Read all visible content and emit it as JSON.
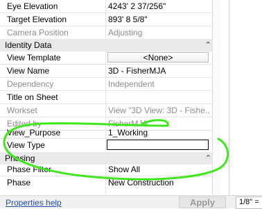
{
  "properties": {
    "camera_rows": [
      {
        "label": "Eye Elevation",
        "value": "4243'  2 37/256\"",
        "disabled": false
      },
      {
        "label": "Target Elevation",
        "value": "893'  8 5/8\"",
        "disabled": false
      },
      {
        "label": "Camera Position",
        "value": "Adjusting",
        "disabled": true
      }
    ],
    "identity_group": {
      "label": "Identity Data",
      "chevron": "⌃"
    },
    "identity_rows": [
      {
        "label": "View Template",
        "value": "<None>",
        "kind": "button",
        "disabled": false
      },
      {
        "label": "View Name",
        "value": "3D - FisherMJA",
        "disabled": false
      },
      {
        "label": "Dependency",
        "value": "Independent",
        "disabled": true
      },
      {
        "label": "Title on Sheet",
        "value": "",
        "disabled": false
      },
      {
        "label": "Workset",
        "value": "View \"3D View: 3D - Fishe...",
        "disabled": true
      },
      {
        "label": "Edited by",
        "value": "FisherMJA",
        "disabled": true
      },
      {
        "label": "View_Purpose",
        "value": "1_Working",
        "disabled": false
      },
      {
        "label": "View Type",
        "value": "",
        "kind": "edit",
        "disabled": false
      }
    ],
    "phasing_group": {
      "label": "Phasing",
      "chevron": "⌃"
    },
    "phasing_rows": [
      {
        "label": "Phase Filter",
        "value": "Show All",
        "disabled": false
      },
      {
        "label": "Phase",
        "value": "New Construction",
        "disabled": false
      }
    ]
  },
  "footer": {
    "help_link": "Properties help",
    "apply_label": "Apply"
  },
  "view_control": {
    "scale": "1/8\" ="
  },
  "colors": {
    "annotation": "#3ee81a",
    "group_bg": "#e9e9e9",
    "link": "#1f4fb5"
  }
}
